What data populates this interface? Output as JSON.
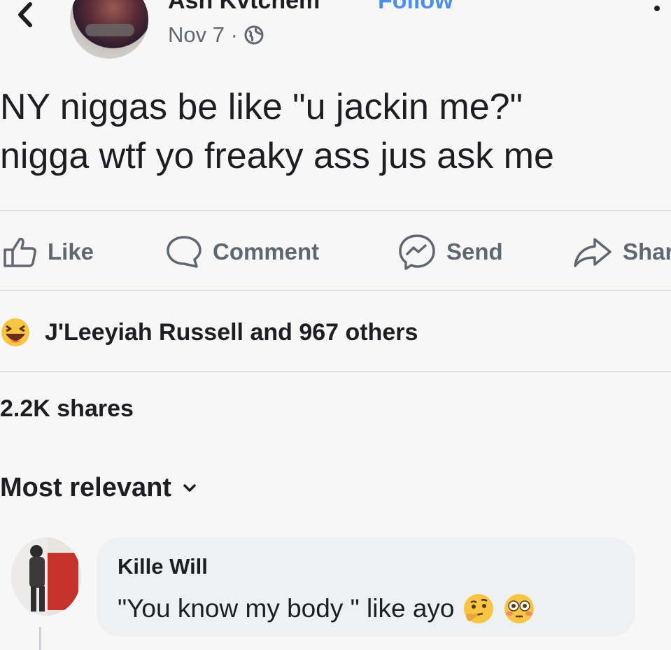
{
  "header": {
    "author_name": "Ash Kvtchem",
    "follow_label": "Follow",
    "timestamp": "Nov 7 ·",
    "privacy_icon": "globe-icon"
  },
  "post": {
    "line1": "NY niggas be like \"u jackin me?\"",
    "line2": "nigga wtf yo freaky ass jus ask me"
  },
  "actions": {
    "like": "Like",
    "comment": "Comment",
    "send": "Send",
    "share": "Share"
  },
  "reactions": {
    "icon": "laughing-emoji-icon",
    "text": "J'Leeyiah Russell and 967 others"
  },
  "shares": "2.2K shares",
  "sort": {
    "label": "Most relevant"
  },
  "comment": {
    "author": "Kille Will",
    "text": "\"You know my body \" like ayo",
    "emojis": [
      "thinking-face-icon",
      "flushed-face-icon"
    ]
  },
  "colors": {
    "link_blue": "#4a8ef0",
    "muted_gray": "#606770",
    "bubble_gray": "#eff0f2"
  }
}
